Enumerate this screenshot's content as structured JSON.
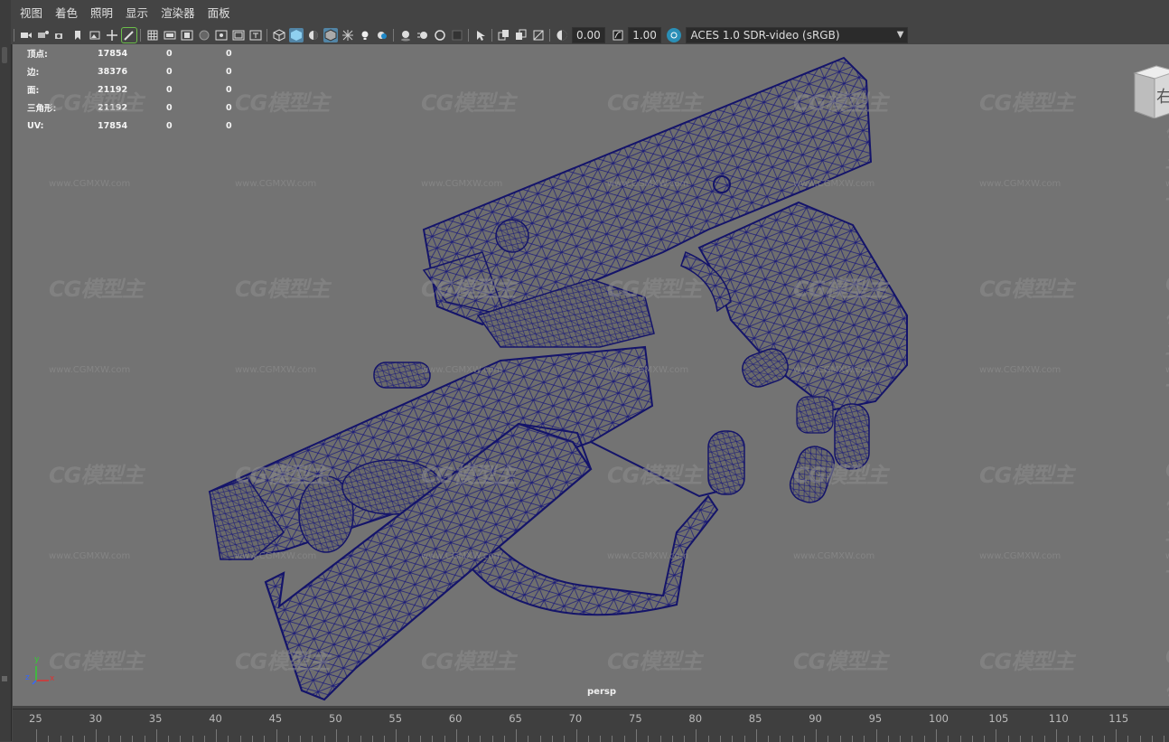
{
  "menubar": {
    "items": [
      "视图",
      "着色",
      "照明",
      "显示",
      "渲染器",
      "面板"
    ]
  },
  "toolbar": {
    "exposure_value": "0.00",
    "gamma_value": "1.00",
    "color_space": "ACES 1.0 SDR-video (sRGB)",
    "icons": [
      "select-camera-icon",
      "camera-attributes-icon",
      "bookmark-icon",
      "image-plane-icon",
      "2d-pan-zoom-icon",
      "grease-pencil-icon",
      "grid-icon",
      "film-gate-icon",
      "resolution-gate-icon",
      "gate-mask-icon",
      "field-chart-icon",
      "safe-action-icon",
      "safe-title-icon",
      "wireframe-icon",
      "smooth-shade-icon",
      "default-material-icon",
      "wireframe-on-shaded-icon",
      "xray-icon",
      "use-all-lights-icon",
      "shadows-icon",
      "screen-space-ao-icon",
      "motion-blur-icon",
      "multisample-aa-icon",
      "depth-of-field-icon",
      "isolate-select-icon",
      "xray-joints-icon",
      "xray-active-icon",
      "exposure-icon",
      "gamma-icon",
      "color-management-icon"
    ]
  },
  "hud": {
    "rows": [
      {
        "label": "顶点:",
        "v1": "17854",
        "v2": "0",
        "v3": "0"
      },
      {
        "label": "边:",
        "v1": "38376",
        "v2": "0",
        "v3": "0"
      },
      {
        "label": "面:",
        "v1": "21192",
        "v2": "0",
        "v3": "0"
      },
      {
        "label": "三角形:",
        "v1": "21192",
        "v2": "0",
        "v3": "0"
      },
      {
        "label": "UV:",
        "v1": "17854",
        "v2": "0",
        "v3": "0"
      }
    ]
  },
  "viewport": {
    "camera": "persp",
    "viewcube_face": "右",
    "watermark_text": "CG模型主",
    "watermark_url": "www.CGMXW.com",
    "axis_labels": {
      "x": "x",
      "y": "y",
      "z": "z"
    },
    "background_color": "#737373",
    "wire_color": "#1b1b7a",
    "mesh_color": "#6e6e6e"
  },
  "timeline": {
    "ticks": [
      "25",
      "30",
      "35",
      "40",
      "45",
      "50",
      "55",
      "60",
      "65",
      "70",
      "75",
      "80",
      "85",
      "90",
      "95",
      "100",
      "105",
      "110",
      "115"
    ]
  }
}
